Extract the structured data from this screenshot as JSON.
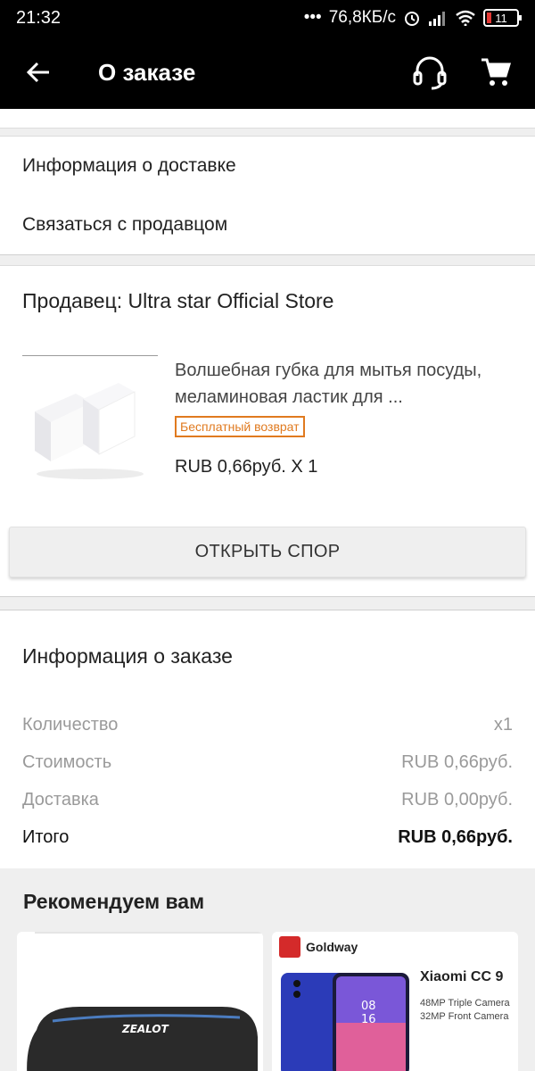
{
  "status_bar": {
    "time": "21:32",
    "speed": "76,8КБ/с",
    "battery": "11"
  },
  "app_bar": {
    "title": "О заказе",
    "icons": [
      "back-arrow-icon",
      "headset-icon",
      "cart-icon"
    ]
  },
  "links": {
    "delivery_info": "Информация о доставке",
    "contact_seller": "Связаться с продавцом"
  },
  "seller_section": {
    "seller": "Продавец: Ultra star Official Store",
    "product": {
      "name": "Волшебная губка для мытья посуды, меламиновая ластик для ...",
      "badge": "Бесплатный возврат",
      "price_line": "RUB 0,66руб. X 1"
    },
    "dispute_button": "ОТКРЫТЬ СПОР"
  },
  "order_info": {
    "title": "Информация о заказе",
    "rows": [
      {
        "label": "Количество",
        "value": "x1"
      },
      {
        "label": "Стоимость",
        "value": "RUB 0,66руб."
      },
      {
        "label": "Доставка",
        "value": "RUB 0,00руб."
      },
      {
        "label": "Итого",
        "value": "RUB 0,66руб."
      }
    ]
  },
  "recommendations": {
    "title": "Рекомендуем вам",
    "items": [
      {
        "brand_on_product": "ZEALOT"
      },
      {
        "store": "Goldway",
        "name": "Xiaomi CC 9",
        "spec1": "48MP Triple Camera",
        "spec2": "32MP Front Camera",
        "screen_time": "08",
        "screen_date": "16"
      }
    ]
  }
}
